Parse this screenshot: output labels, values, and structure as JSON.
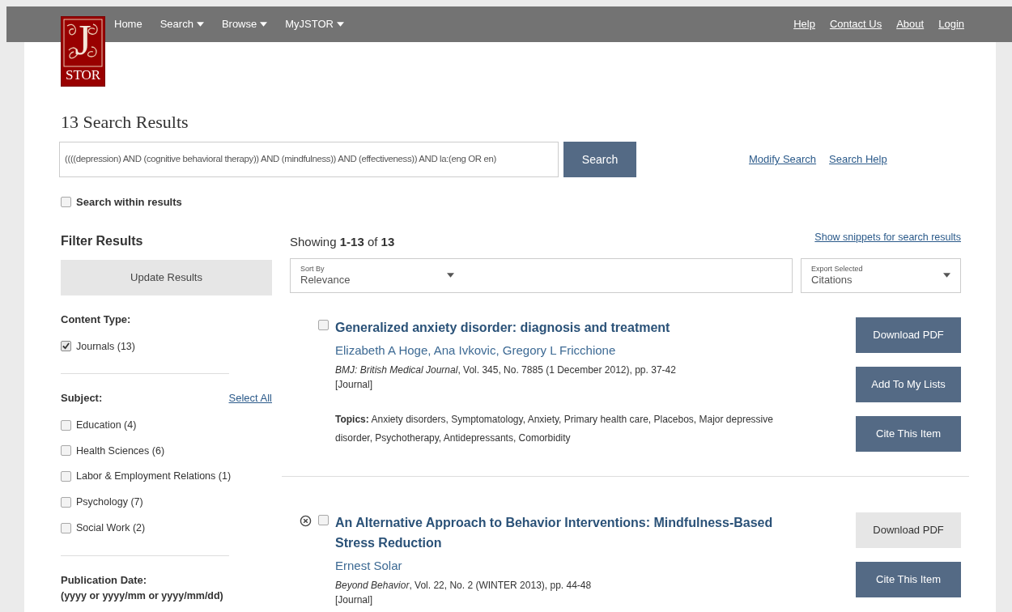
{
  "logo": {
    "letter": "J",
    "text": "STOR"
  },
  "nav": {
    "left": [
      {
        "label": "Home",
        "dropdown": false
      },
      {
        "label": "Search",
        "dropdown": true
      },
      {
        "label": "Browse",
        "dropdown": true
      },
      {
        "label": "MyJSTOR",
        "dropdown": true
      }
    ],
    "right": [
      "Help",
      "Contact Us",
      "About",
      "Login"
    ]
  },
  "page_title": "13 Search Results",
  "search": {
    "value": "((((depression) AND (cognitive behavioral therapy)) AND (mindfulness)) AND (effectiveness)) AND la:(eng OR en)",
    "button": "Search",
    "links": [
      "Modify Search",
      "Search Help"
    ]
  },
  "search_within": {
    "label": "Search within results",
    "checked": false
  },
  "filters": {
    "title": "Filter Results",
    "update_button": "Update Results",
    "sections": [
      {
        "title": "Content Type:",
        "items": [
          {
            "label": "Journals (13)",
            "checked": true
          }
        ]
      },
      {
        "title": "Subject:",
        "action": "Select All",
        "items": [
          {
            "label": "Education (4)",
            "checked": false
          },
          {
            "label": "Health Sciences (6)",
            "checked": false
          },
          {
            "label": "Labor & Employment Relations (1)",
            "checked": false
          },
          {
            "label": "Psychology (7)",
            "checked": false
          },
          {
            "label": "Social Work (2)",
            "checked": false
          }
        ]
      },
      {
        "title": "Publication Date:",
        "hint": "(yyyy or yyyy/mm or yyyy/mm/dd)"
      }
    ]
  },
  "results_header": {
    "showing": "Showing **1-13** of **13**",
    "snippets_link": "Show snippets for search results",
    "sort": {
      "label": "Sort By",
      "value": "Relevance"
    },
    "export": {
      "label": "Export Selected",
      "value": "Citations"
    }
  },
  "results": [
    {
      "removable": false,
      "checked": false,
      "title": "Generalized anxiety disorder: diagnosis and treatment",
      "authors": "Elizabeth A Hoge, Ana Ivkovic, Gregory L Fricchione",
      "citation": "*BMJ: British Medical Journal*, Vol. 345, No. 7885 (1 December 2012), pp. 37-42",
      "type": "[Journal]",
      "topics_label": "Topics:",
      "topics": "Anxiety disorders, Symptomatology, Anxiety, Primary health care, Placebos, Major depressive disorder, Psychotherapy, Antidepressants, Comorbidity",
      "buttons": [
        {
          "label": "Download PDF",
          "disabled": false
        },
        {
          "label": "Add To My Lists",
          "disabled": false
        },
        {
          "label": "Cite This Item",
          "disabled": false
        }
      ]
    },
    {
      "removable": true,
      "checked": false,
      "title": "An Alternative Approach to Behavior Interventions: Mindfulness-Based Stress Reduction",
      "authors": "Ernest Solar",
      "citation": "*Beyond Behavior*, Vol. 22, No. 2 (WINTER 2013), pp. 44-48",
      "type": "[Journal]",
      "buttons": [
        {
          "label": "Download PDF",
          "disabled": true
        },
        {
          "label": "Cite This Item",
          "disabled": false
        }
      ]
    }
  ]
}
